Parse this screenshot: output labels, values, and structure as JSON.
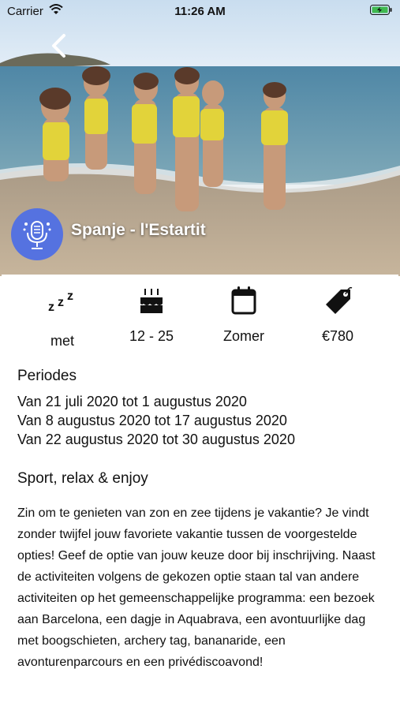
{
  "status_bar": {
    "carrier": "Carrier",
    "time": "11:26 AM"
  },
  "header": {
    "title": "Spanje - l'Estartit",
    "back_icon": "chevron-left-icon"
  },
  "features": [
    {
      "icon": "sleep-zzz-icon",
      "label": "met"
    },
    {
      "icon": "birthday-cake-icon",
      "label": "12 - 25"
    },
    {
      "icon": "calendar-icon",
      "label": "Zomer"
    },
    {
      "icon": "price-tag-icon",
      "label": "€780"
    }
  ],
  "periodes": {
    "title": "Periodes",
    "items": [
      "Van 21 juli 2020 tot 1 augustus 2020",
      "Van 8 augustus 2020 tot 17 augustus 2020",
      "Van 22 augustus 2020 tot 30 augustus 2020"
    ]
  },
  "sport": {
    "title": "Sport, relax & enjoy",
    "description": "Zin om te genieten van zon en zee tijdens je vakantie? Je vindt zonder twijfel jouw favoriete vakantie tussen de voorgestelde opties! Geef de optie van jouw keuze door bij inschrijving. Naast de activiteiten volgens de gekozen optie staan tal van andere activiteiten op het gemeenschappelijke programma: een bezoek aan Barcelona, een dagje in Aquabrava, een avontuurlijke dag met boogschieten, archery tag, bananaride, een avonturenparcours en een privédiscoavond!"
  },
  "colors": {
    "avatar": "#5572e0",
    "sky": "#cfe2f2",
    "sea": "#5f8fa8",
    "sand": "#b9a58c",
    "vest": "#e2d33a"
  }
}
